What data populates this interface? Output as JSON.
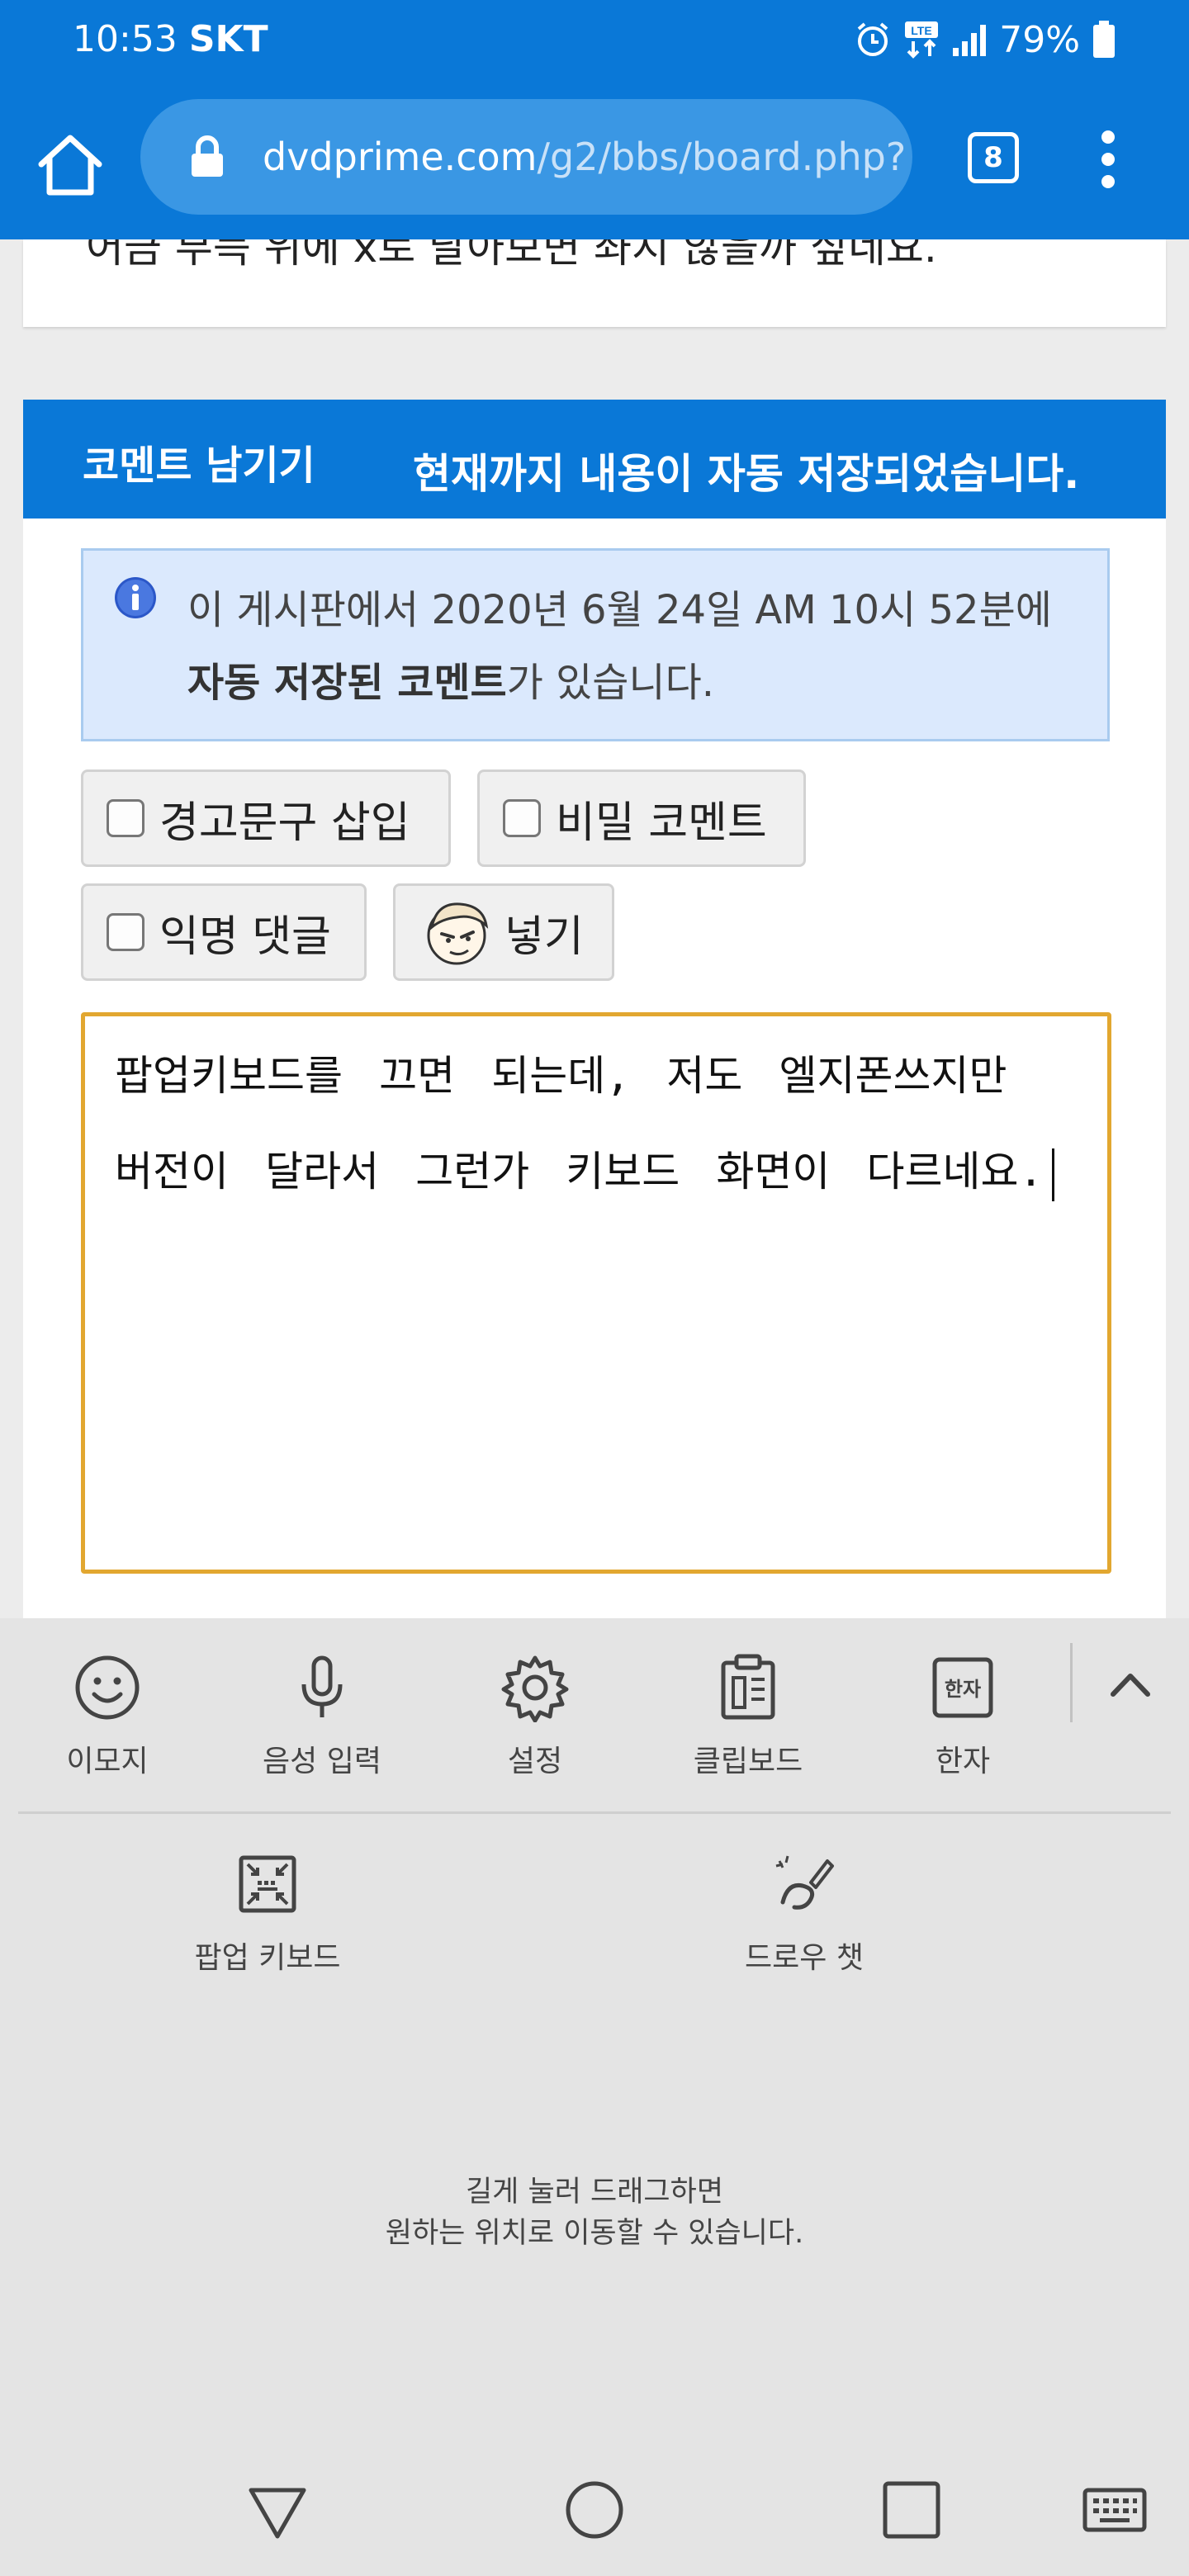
{
  "status_bar": {
    "time": "10:53",
    "carrier": "SKT",
    "network": "LTE",
    "battery": "79%"
  },
  "browser": {
    "url_domain": "dvdprime.com",
    "url_path": "/g2/bbs/board.php?",
    "tab_count": "8"
  },
  "page": {
    "previous_comment_clipped": "어금 부득 위에 x로 달아보면 좌지 않을까 싶네요.",
    "comment_section": {
      "title": "코멘트 남기기",
      "autosave_notice": "현재까지 내용이 자동 저장되었습니다.",
      "info": {
        "before": "이 게시판에서 2020년 6월 24일 AM 10시 52분에 ",
        "bold": "자동 저장된 코멘트",
        "after": "가 있습니다."
      },
      "options": {
        "warning_insert": "경고문구 삽입",
        "secret_comment": "비밀 코멘트",
        "anonymous_reply": "익명 댓글",
        "insert_emoticon": "넣기"
      },
      "textarea_value": "팝업키보드를 끄면 되는데, 저도 엘지폰쓰지만 버전이 달라서 그런가 키보드 화면이 다르네요."
    }
  },
  "keyboard_toolbar": {
    "items": {
      "emoji": "이모지",
      "voice": "음성 입력",
      "settings": "설정",
      "clipboard": "클립보드",
      "hanja": "한자",
      "hanja_icon_text": "한자",
      "popup_keyboard": "팝업 키보드",
      "draw_chat": "드로우 챗"
    },
    "hint_line1": "길게 눌러 드래그하면",
    "hint_line2": "원하는 위치로 이동할 수 있습니다."
  }
}
